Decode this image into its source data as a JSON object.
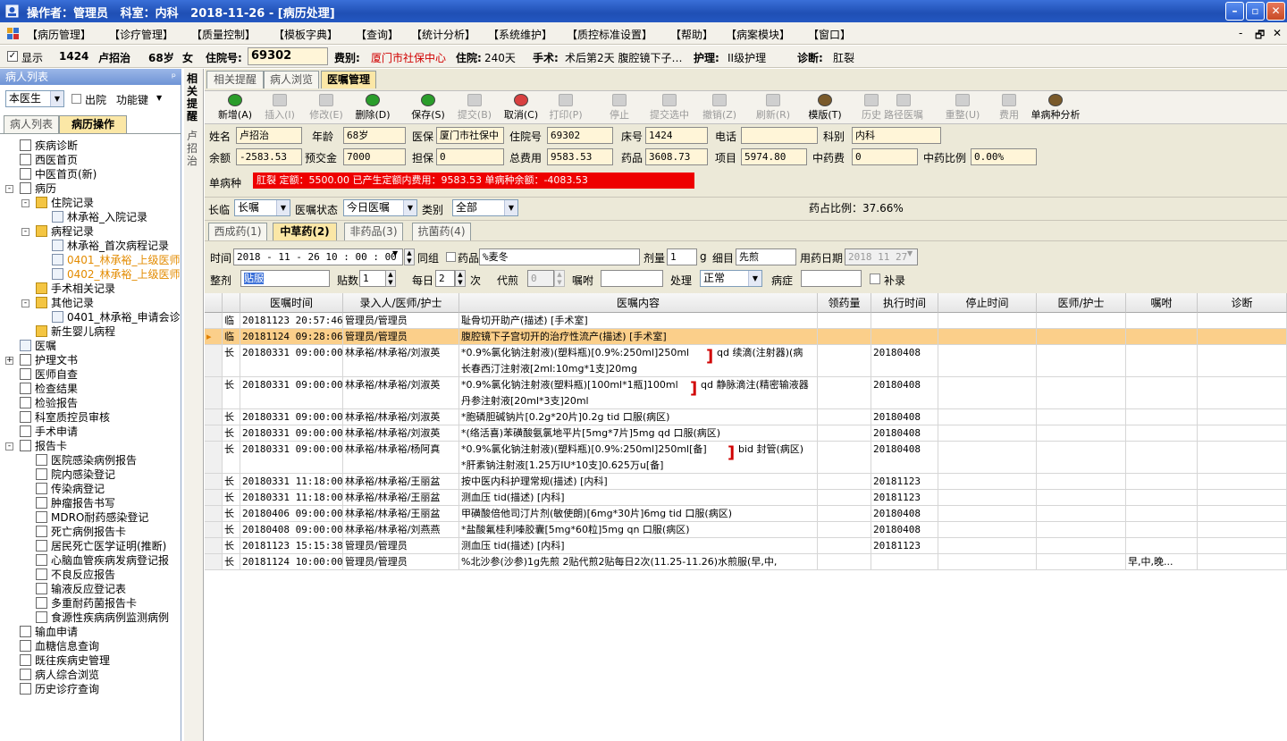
{
  "titlebar": {
    "title": "操作者：管理员   科室：内科   2018-11-26 - [病历处理]"
  },
  "menu": [
    "【病历管理】",
    "【诊疗管理】",
    "【质量控制】",
    "【模板字典】",
    "【查询】",
    "【统计分析】",
    "【系统维护】",
    "【质控标准设置】",
    "【帮助】",
    "【病案模块】",
    "【窗口】"
  ],
  "menu_controls": [
    "-",
    "🗗",
    "✕"
  ],
  "infobar": {
    "show_label": "显示",
    "bed": "1424",
    "name": "卢招治",
    "age": "68岁",
    "sex": "女",
    "inpatient_label": "住院号:",
    "inpatient_no": "69302",
    "fee_label": "费别:",
    "fee_value": "厦门市社保中心",
    "stay_label": "住院:",
    "stay_value": "240天",
    "surgery_label": "手术:",
    "surgery_value": "术后第2天  腹腔镜下子…",
    "nursing_label": "护理:",
    "nursing_value": "II级护理",
    "diag_label": "诊断:",
    "diag_value": "肛裂"
  },
  "leftpanel": {
    "header": "病人列表",
    "pin": "ᵖ",
    "doctor_select": "本医生",
    "discharged_label": "出院",
    "funckey_label": "功能键",
    "tabs": [
      "病人列表",
      "病历操作"
    ],
    "tree": [
      {
        "label": "疾病诊断",
        "lvl": 1,
        "icon": "doc"
      },
      {
        "label": "西医首页",
        "lvl": 1,
        "icon": "doc"
      },
      {
        "label": "中医首页(新)",
        "lvl": 1,
        "icon": "doc"
      },
      {
        "label": "病历",
        "lvl": 1,
        "icon": "doc",
        "pm": "-"
      },
      {
        "label": "住院记录",
        "lvl": 2,
        "icon": "fold",
        "pm": "-"
      },
      {
        "label": "林承裕_入院记录",
        "lvl": 3,
        "icon": "sub"
      },
      {
        "label": "病程记录",
        "lvl": 2,
        "icon": "fold",
        "pm": "-"
      },
      {
        "label": "林承裕_首次病程记录",
        "lvl": 3,
        "icon": "sub"
      },
      {
        "label": "0401_林承裕_上级医师",
        "lvl": 3,
        "icon": "sub",
        "color": "#e38b00"
      },
      {
        "label": "0402_林承裕_上级医师",
        "lvl": 3,
        "icon": "sub",
        "color": "#e38b00"
      },
      {
        "label": "手术相关记录",
        "lvl": 2,
        "icon": "fold"
      },
      {
        "label": "其他记录",
        "lvl": 2,
        "icon": "fold",
        "pm": "-"
      },
      {
        "label": "0401_林承裕_申请会诊",
        "lvl": 3,
        "icon": "sub"
      },
      {
        "label": "新生婴儿病程",
        "lvl": 2,
        "icon": "fold"
      },
      {
        "label": "医嘱",
        "lvl": 1,
        "icon": "sub"
      },
      {
        "label": "护理文书",
        "lvl": 1,
        "icon": "doc",
        "pm": "+"
      },
      {
        "label": "医师自查",
        "lvl": 1,
        "icon": "doc"
      },
      {
        "label": "检查结果",
        "lvl": 1,
        "icon": "doc"
      },
      {
        "label": "检验报告",
        "lvl": 1,
        "icon": "doc"
      },
      {
        "label": "科室质控员审核",
        "lvl": 1,
        "icon": "doc"
      },
      {
        "label": "手术申请",
        "lvl": 1,
        "icon": "doc"
      },
      {
        "label": "报告卡",
        "lvl": 1,
        "icon": "doc",
        "pm": "-"
      },
      {
        "label": "医院感染病例报告",
        "lvl": 2,
        "icon": "doc"
      },
      {
        "label": "院内感染登记",
        "lvl": 2,
        "icon": "doc"
      },
      {
        "label": "传染病登记",
        "lvl": 2,
        "icon": "doc"
      },
      {
        "label": "肿瘤报告书写",
        "lvl": 2,
        "icon": "doc"
      },
      {
        "label": "MDRO耐药感染登记",
        "lvl": 2,
        "icon": "doc"
      },
      {
        "label": "死亡病例报告卡",
        "lvl": 2,
        "icon": "doc"
      },
      {
        "label": "居民死亡医学证明(推断)",
        "lvl": 2,
        "icon": "doc"
      },
      {
        "label": "心脑血管疾病发病登记报",
        "lvl": 2,
        "icon": "doc"
      },
      {
        "label": "不良反应报告",
        "lvl": 2,
        "icon": "doc"
      },
      {
        "label": "输液反应登记表",
        "lvl": 2,
        "icon": "doc"
      },
      {
        "label": "多重耐药菌报告卡",
        "lvl": 2,
        "icon": "doc"
      },
      {
        "label": "食源性疾病病例监测病例",
        "lvl": 2,
        "icon": "doc"
      },
      {
        "label": "输血申请",
        "lvl": 1,
        "icon": "doc"
      },
      {
        "label": "血糖信息查询",
        "lvl": 1,
        "icon": "doc"
      },
      {
        "label": "既往疾病史管理",
        "lvl": 1,
        "icon": "doc"
      },
      {
        "label": "病人综合浏览",
        "lvl": 1,
        "icon": "doc"
      },
      {
        "label": "历史诊疗查询",
        "lvl": 1,
        "icon": "doc"
      }
    ]
  },
  "vtab_label": "相关提醒",
  "vtab_name": "卢招治",
  "main_tabs": [
    "相关提醒",
    "病人浏览",
    "医嘱管理"
  ],
  "toolbar": [
    {
      "label": "新增(A)",
      "enabled": true,
      "color": "#2a9d2a"
    },
    {
      "label": "插入(I)",
      "enabled": false
    },
    {
      "label": "修改(E)",
      "enabled": false
    },
    {
      "label": "删除(D)",
      "enabled": true,
      "color": "#2a9d2a"
    },
    {
      "label": "保存(S)",
      "enabled": true,
      "color": "#2a9d2a"
    },
    {
      "label": "提交(B)",
      "enabled": false
    },
    {
      "label": "取消(C)",
      "enabled": true,
      "color": "#d84040"
    },
    {
      "label": "打印(P)",
      "enabled": false
    },
    {
      "label": "停止",
      "enabled": false
    },
    {
      "label": "提交选中",
      "enabled": false
    },
    {
      "label": "撤销(Z)",
      "enabled": false
    },
    {
      "label": "刷新(R)",
      "enabled": false
    },
    {
      "label": "模版(T)",
      "enabled": true,
      "color": "#7a5a2a"
    },
    {
      "label": "历史",
      "enabled": false
    },
    {
      "label": "路径医嘱",
      "enabled": false
    },
    {
      "label": "重整(U)",
      "enabled": false
    },
    {
      "label": "费用",
      "enabled": false
    },
    {
      "label": "单病种分析",
      "enabled": true,
      "color": "#7a5a2a"
    }
  ],
  "patient_form": {
    "name_label": "姓名",
    "name": "卢招治",
    "age_label": "年龄",
    "age": "68岁",
    "insurance_label": "医保",
    "insurance": "厦门市社保中",
    "inpatient_label": "住院号",
    "inpatient": "69302",
    "bed_label": "床号",
    "bed": "1424",
    "phone_label": "电话",
    "phone": "",
    "dept_label": "科别",
    "dept": "内科",
    "balance_label": "余额",
    "balance": "-2583.53",
    "deposit_label": "预交金",
    "deposit": "7000",
    "guarantee_label": "担保",
    "guarantee": "0",
    "total_label": "总费用",
    "total": "9583.53",
    "drug_label": "药品",
    "drug": "3608.73",
    "item_label": "项目",
    "item": "5974.80",
    "tcm_label": "中药费",
    "tcm": "0",
    "tcm_ratio_label": "中药比例",
    "tcm_ratio": "0.00%",
    "single_disease_label": "单病种",
    "single_disease_text": "肛裂   定额：5500.00   已产生定额内费用：9583.53   单病种余额：-4083.53"
  },
  "filter": {
    "type_label": "长临",
    "type_value": "长嘱",
    "status_label": "医嘱状态",
    "status_value": "今日医嘱",
    "category_label": "类别",
    "category_value": "全部",
    "ratio_text": "药占比例：37.66%"
  },
  "drug_tabs": [
    "西成药(1)",
    "中草药(2)",
    "非药品(3)",
    "抗菌药(4)"
  ],
  "entry": {
    "time_label": "时间",
    "time_value": "2018 - 11 - 26    10 : 00 : 00",
    "group_label": "同组",
    "drug_label": "药品",
    "drug_value": "%麦冬",
    "dose_label": "剂量",
    "dose_value": "1",
    "dose_unit": "g",
    "detail_label": "细目",
    "detail_value": "先煎",
    "date_label": "用药日期",
    "date_value": "2018 11 27",
    "whole_label": "整剂",
    "whole_value": "贴服",
    "packs_label": "贴数",
    "packs_value": "1",
    "daily_label": "每日",
    "daily_value": "2",
    "times_label": "次",
    "decoct_label": "代煎",
    "decoct_value": "0",
    "advice_label": "嘱咐",
    "advice_value": "",
    "handle_label": "处理",
    "handle_value": "正常",
    "symptom_label": "病症",
    "symptom_value": "",
    "supplement_label": "补录"
  },
  "grid": {
    "columns": [
      "医嘱时间",
      "录入人/医师/护士",
      "医嘱内容",
      "领药量",
      "执行时间",
      "停止时间",
      "医师/护士",
      "嘱咐",
      "诊断"
    ],
    "rows": [
      {
        "t": "临",
        "time": "20181123 20:57:46",
        "who": "管理员/管理员",
        "content": [
          "耻骨切开助产(描述)  [手术室]"
        ],
        "exec": "",
        "note": ""
      },
      {
        "t": "临",
        "time": "20181124 09:28:06",
        "who": "管理员/管理员",
        "content": [
          "腹腔镜下子宫切开的治疗性流产(描述)  [手术室]"
        ],
        "exec": "",
        "note": "",
        "selected": true
      },
      {
        "t": "长",
        "time": "20180331 09:00:00",
        "who": "林承裕/林承裕/刘淑英",
        "content": [
          "*0.9%氯化钠注射液)(塑料瓶)[0.9%:250ml]250ml",
          "长春西汀注射液[2ml:10mg*1支]20mg"
        ],
        "bracket": "qd 续滴(注射器)(病",
        "exec": "20180408",
        "note": ""
      },
      {
        "t": "长",
        "time": "20180331 09:00:00",
        "who": "林承裕/林承裕/刘淑英",
        "content": [
          "*0.9%氯化钠注射液(塑料瓶)[100ml*1瓶]100ml",
          "丹参注射液[20ml*3支]20ml"
        ],
        "bracket": "qd 静脉滴注(精密输液器",
        "exec": "20180408",
        "note": ""
      },
      {
        "t": "长",
        "time": "20180331 09:00:00",
        "who": "林承裕/林承裕/刘淑英",
        "content": [
          "*胞磷胆碱钠片[0.2g*20片]0.2g  tid 口服(病区)"
        ],
        "exec": "20180408",
        "note": ""
      },
      {
        "t": "长",
        "time": "20180331 09:00:00",
        "who": "林承裕/林承裕/刘淑英",
        "content": [
          "*(络活喜)苯磺酸氨氯地平片[5mg*7片]5mg  qd 口服(病区)"
        ],
        "exec": "20180408",
        "note": ""
      },
      {
        "t": "长",
        "time": "20180331 09:00:00",
        "who": "林承裕/林承裕/杨阿真",
        "content": [
          "*0.9%氯化钠注射液)(塑料瓶)[0.9%:250ml]250ml[备]",
          "*肝素钠注射液[1.25万IU*10支]0.625万u[备]"
        ],
        "bracket": "bid 封管(病区)",
        "exec": "20180408",
        "note": ""
      },
      {
        "t": "长",
        "time": "20180331 11:18:00",
        "who": "林承裕/林承裕/王丽盆",
        "content": [
          "按中医内科护理常规(描述)  [内科]"
        ],
        "exec": "20181123",
        "note": ""
      },
      {
        "t": "长",
        "time": "20180331 11:18:00",
        "who": "林承裕/林承裕/王丽盆",
        "content": [
          "测血压 tid(描述)  [内科]"
        ],
        "exec": "20181123",
        "note": ""
      },
      {
        "t": "长",
        "time": "20180406 09:00:00",
        "who": "林承裕/林承裕/王丽盆",
        "content": [
          "甲磺酸倍他司汀片剂(敏使朗)[6mg*30片]6mg  tid 口服(病区)"
        ],
        "exec": "20180408",
        "note": ""
      },
      {
        "t": "长",
        "time": "20180408 09:00:00",
        "who": "林承裕/林承裕/刘燕燕",
        "content": [
          "*盐酸氟桂利嗪胶囊[5mg*60粒]5mg  qn 口服(病区)"
        ],
        "exec": "20180408",
        "note": ""
      },
      {
        "t": "长",
        "time": "20181123 15:15:38",
        "who": "管理员/管理员",
        "content": [
          "测血压 tid(描述)  [内科]"
        ],
        "exec": "20181123",
        "note": ""
      },
      {
        "t": "长",
        "time": "20181124 10:00:00",
        "who": "管理员/管理员",
        "content": [
          "%北沙参(沙参)1g先煎   2贴代煎2贴每日2次(11.25-11.26)水煎服(早,中,"
        ],
        "exec": "",
        "note": "早,中,晚..."
      }
    ]
  }
}
